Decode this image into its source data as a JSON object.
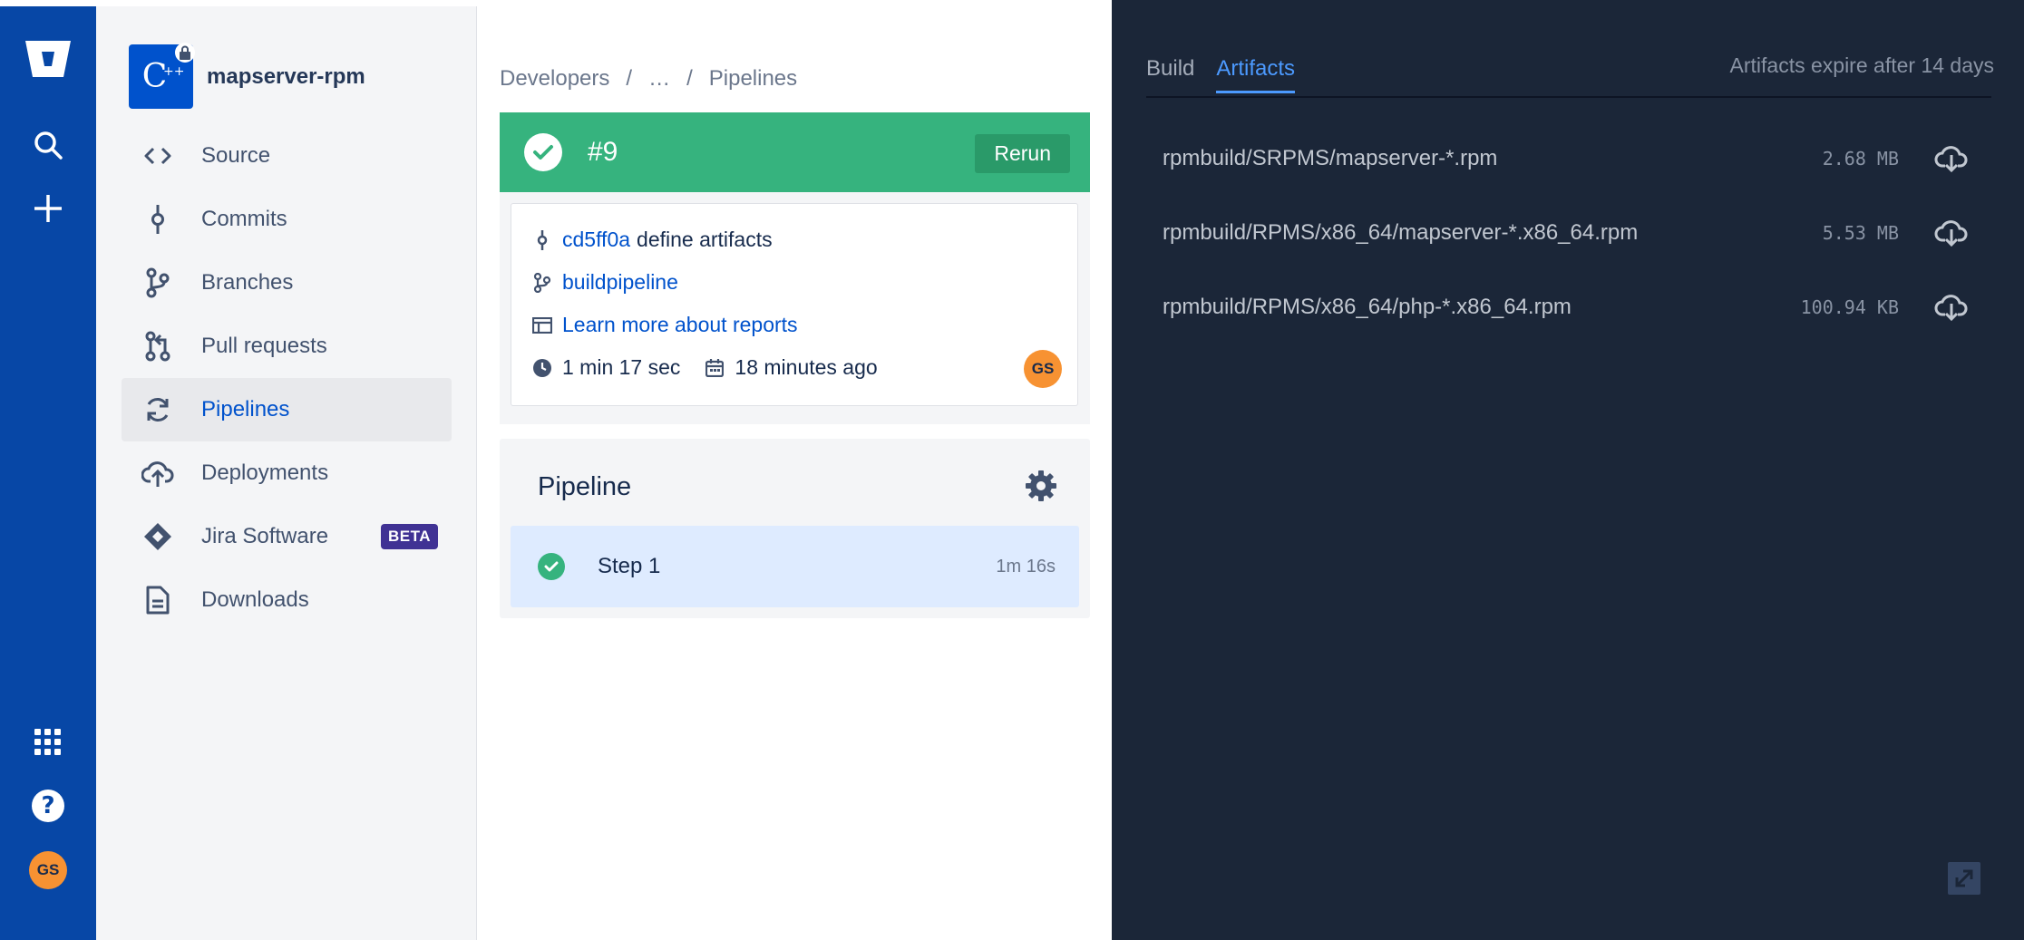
{
  "global_nav": {
    "avatar_initials": "GS"
  },
  "repo": {
    "name": "mapserver-rpm",
    "avatar_text": "C",
    "avatar_sup": "++"
  },
  "sidebar": {
    "items": [
      {
        "label": "Source",
        "icon": "code-icon"
      },
      {
        "label": "Commits",
        "icon": "commit-icon"
      },
      {
        "label": "Branches",
        "icon": "branch-icon"
      },
      {
        "label": "Pull requests",
        "icon": "pull-request-icon"
      },
      {
        "label": "Pipelines",
        "icon": "pipelines-icon",
        "active": true
      },
      {
        "label": "Deployments",
        "icon": "cloud-upload-icon"
      },
      {
        "label": "Jira Software",
        "icon": "jira-icon",
        "badge": "BETA"
      },
      {
        "label": "Downloads",
        "icon": "document-icon"
      }
    ]
  },
  "breadcrumb": {
    "items": [
      "Developers",
      "/",
      "…",
      "/",
      "Pipelines"
    ]
  },
  "result": {
    "number": "#9",
    "status": "success",
    "rerun_label": "Rerun"
  },
  "info": {
    "commit_hash": "cd5ff0a",
    "commit_message": "define artifacts",
    "branch": "buildpipeline",
    "reports_link": "Learn more about reports",
    "duration": "1 min 17 sec",
    "time_ago": "18 minutes ago",
    "author_initials": "GS"
  },
  "pipeline": {
    "title": "Pipeline",
    "steps": [
      {
        "label": "Step 1",
        "time": "1m 16s",
        "status": "success"
      }
    ]
  },
  "artifacts_panel": {
    "tabs": [
      {
        "label": "Build",
        "active": false
      },
      {
        "label": "Artifacts",
        "active": true
      }
    ],
    "expire_note": "Artifacts expire after 14 days",
    "items": [
      {
        "name": "rpmbuild/SRPMS/mapserver-*.rpm",
        "size": "2.68 MB"
      },
      {
        "name": "rpmbuild/RPMS/x86_64/mapserver-*.x86_64.rpm",
        "size": "5.53 MB"
      },
      {
        "name": "rpmbuild/RPMS/x86_64/php-*.x86_64.rpm",
        "size": "100.94 KB"
      }
    ]
  },
  "colors": {
    "global_nav": "#0747a6",
    "success": "#36b37e",
    "link": "#0052cc",
    "dark_panel": "#1b2638",
    "active_tab": "#4c9aff"
  }
}
